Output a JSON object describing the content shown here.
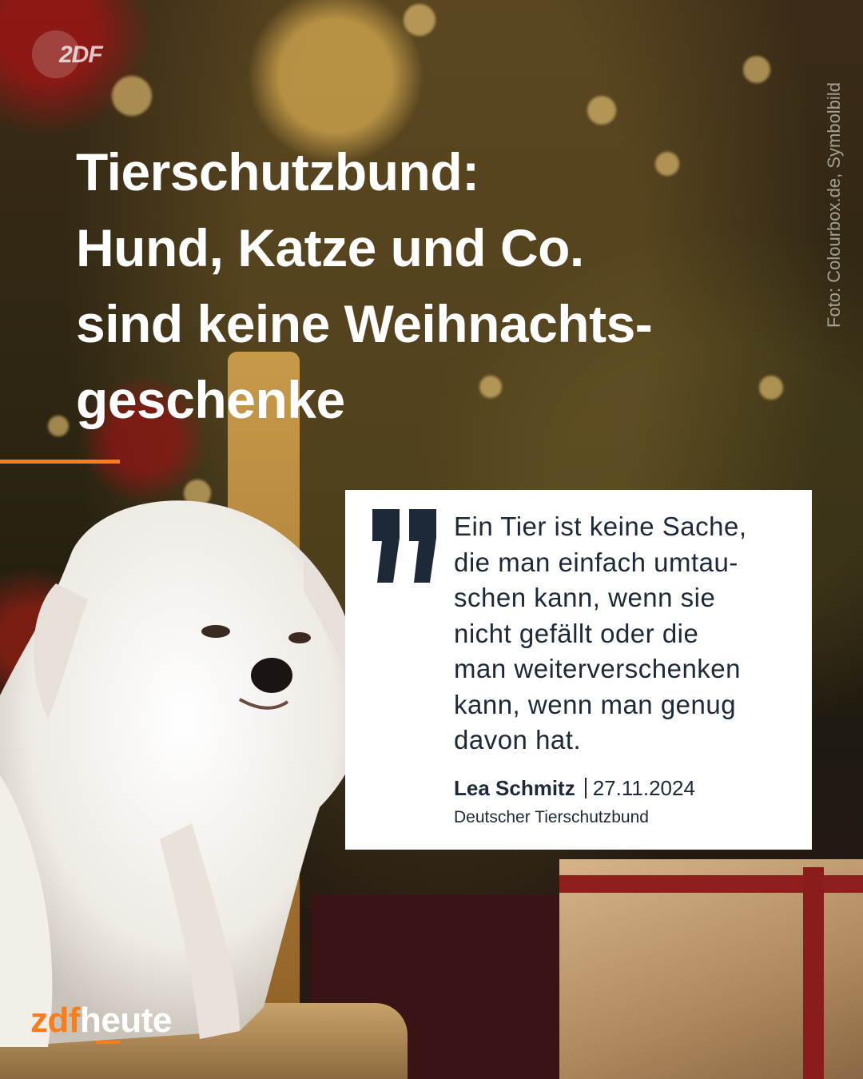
{
  "corner_logo": {
    "text": "2DF"
  },
  "photo_credit": "Foto: Colourbox.de, Symbolbild",
  "headline": {
    "lines": [
      "Tierschutzbund:",
      "Hund, Katze und Co.",
      "sind keine Weihnachts-",
      "geschenke"
    ]
  },
  "quote": {
    "lines": [
      "Ein Tier ist keine Sache,",
      "die man einfach umtau-",
      "schen kann, wenn sie",
      "nicht gefällt oder die",
      "man weiterverschenken",
      "kann, wenn man genug",
      "davon hat."
    ],
    "author": "Lea Schmitz",
    "date": "27.11.2024",
    "organization": "Deutscher Tierschutzbund"
  },
  "brand": {
    "part1": "zdf",
    "part2": "heute"
  },
  "colors": {
    "accent": "#fa7d19",
    "text_dark": "#1d2936",
    "card_bg": "#ffffff"
  }
}
